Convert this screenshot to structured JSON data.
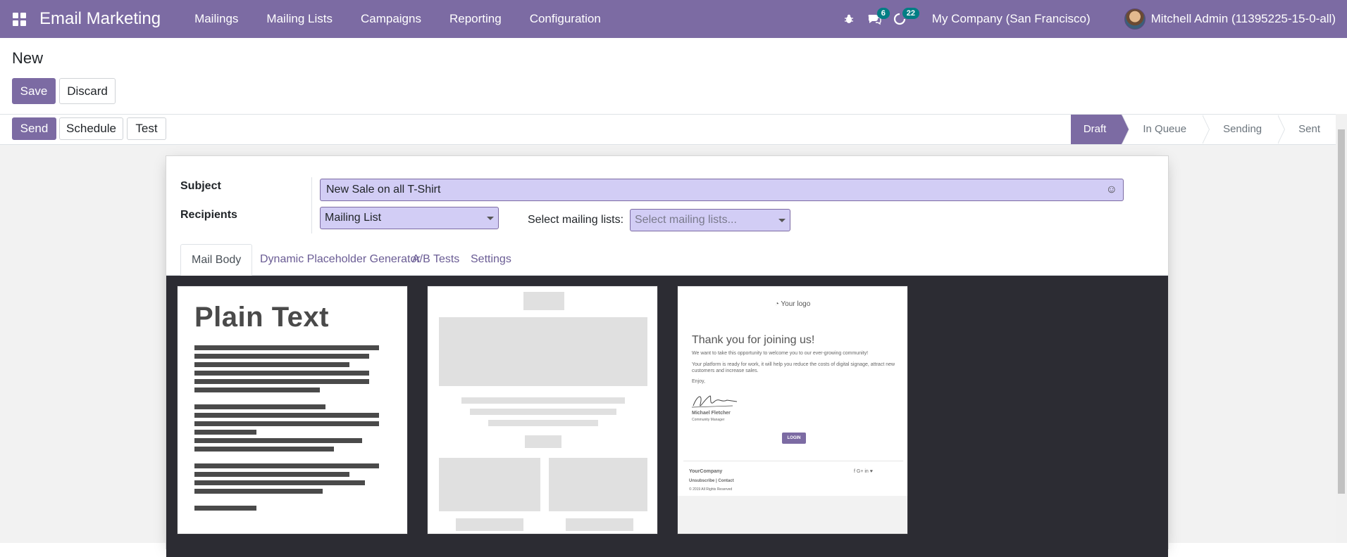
{
  "navbar": {
    "app_name": "Email Marketing",
    "menu": [
      "Mailings",
      "Mailing Lists",
      "Campaigns",
      "Reporting",
      "Configuration"
    ],
    "messages_badge": "6",
    "activities_badge": "22",
    "company": "My Company (San Francisco)",
    "user": "Mitchell Admin (11395225-15-0-all)"
  },
  "control_panel": {
    "title": "New",
    "save_label": "Save",
    "discard_label": "Discard"
  },
  "statusbar": {
    "buttons": {
      "send": "Send",
      "schedule": "Schedule",
      "test": "Test"
    },
    "stages": [
      "Draft",
      "In Queue",
      "Sending",
      "Sent"
    ],
    "active_stage": "Draft"
  },
  "form": {
    "subject_label": "Subject",
    "subject_value": "New Sale on all T-Shirt",
    "recipients_label": "Recipients",
    "recipients_value": "Mailing List",
    "mailing_lists_label": "Select mailing lists:",
    "mailing_lists_placeholder": "Select mailing lists..."
  },
  "tabs": [
    "Mail Body",
    "Dynamic Placeholder Generator",
    "A/B Tests",
    "Settings"
  ],
  "active_tab": "Mail Body",
  "templates": {
    "plain_text_title": "Plain Text",
    "welcome": {
      "logo": "Your logo",
      "heading": "Thank you for joining us!",
      "line1": "We want to take this opportunity to welcome you to our ever-growing community!",
      "line2": "Your platform is ready for work, it will help you reduce the costs of digital signage, attract new customers and increase sales.",
      "enjoy": "Enjoy,",
      "signer": "Michael Fletcher",
      "signer_role": "Community Manager",
      "login": "LOGIN",
      "company": "YourCompany",
      "links": "Unsubscribe | Contact",
      "copyright": "© 2019 All Rights Reserved",
      "social": "f  G+  in  ♥"
    }
  },
  "colors": {
    "brand": "#7c6ba3",
    "field_bg": "#d2cdf5",
    "badge": "#017e84",
    "editor_bg": "#2c2c33"
  }
}
